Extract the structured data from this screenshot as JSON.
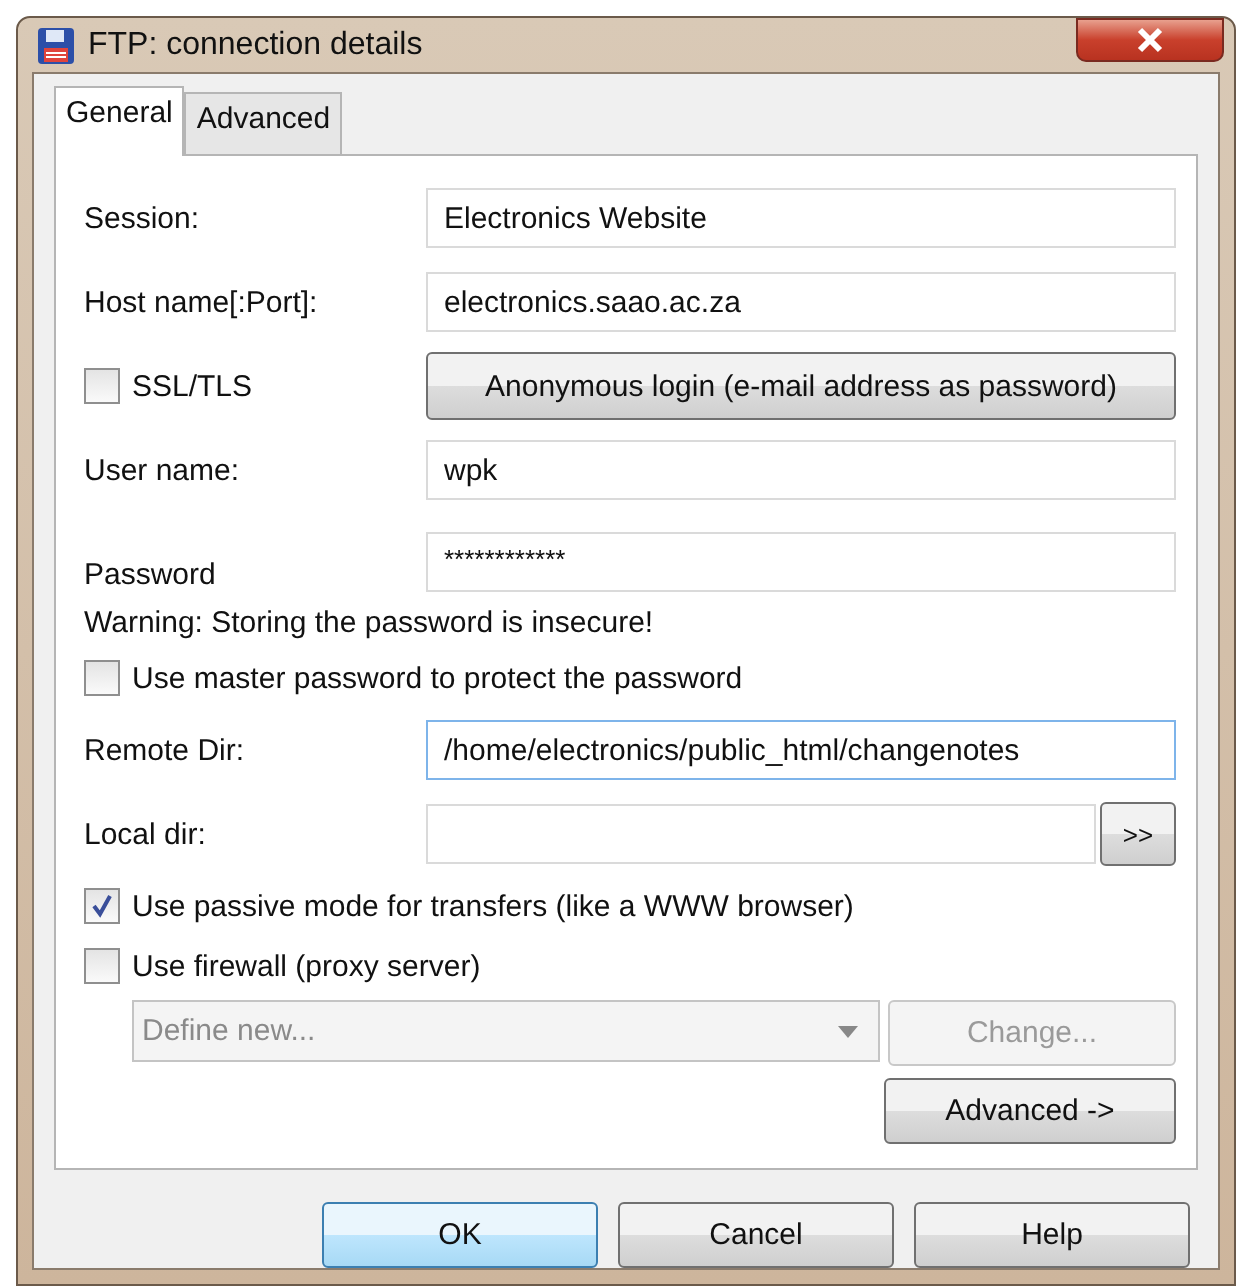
{
  "window": {
    "title": "FTP: connection details"
  },
  "tabs": [
    {
      "label": "General",
      "selected": true
    },
    {
      "label": "Advanced",
      "selected": false
    }
  ],
  "session": {
    "label": "Session:",
    "value": "Electronics Website"
  },
  "host": {
    "label": "Host name[:Port]:",
    "value": "electronics.saao.ac.za"
  },
  "ssl": {
    "label": "SSL/TLS",
    "checked": false
  },
  "anonymous_button": "Anonymous login (e-mail address as password)",
  "user": {
    "label": "User name:",
    "value": "wpk"
  },
  "password": {
    "label": "Password",
    "value": "************"
  },
  "warning": "Warning: Storing the password is insecure!",
  "master_password": {
    "label": "Use master password to protect the password",
    "checked": false
  },
  "remote_dir": {
    "label": "Remote Dir:",
    "value": "/home/electronics/public_html/changenotes"
  },
  "local_dir": {
    "label": "Local dir:",
    "browse_button": ">>"
  },
  "passive": {
    "label": "Use passive mode for transfers (like a WWW browser)",
    "checked": true
  },
  "firewall": {
    "label": "Use firewall (proxy server)",
    "checked": false
  },
  "proxy": {
    "value": "Define new...",
    "disabled": true
  },
  "change_button": {
    "label": "Change...",
    "disabled": true
  },
  "advanced_button": "Advanced ->",
  "buttons": [
    {
      "label": "OK",
      "default": true
    },
    {
      "label": "Cancel",
      "default": false
    },
    {
      "label": "Help",
      "default": false
    }
  ]
}
